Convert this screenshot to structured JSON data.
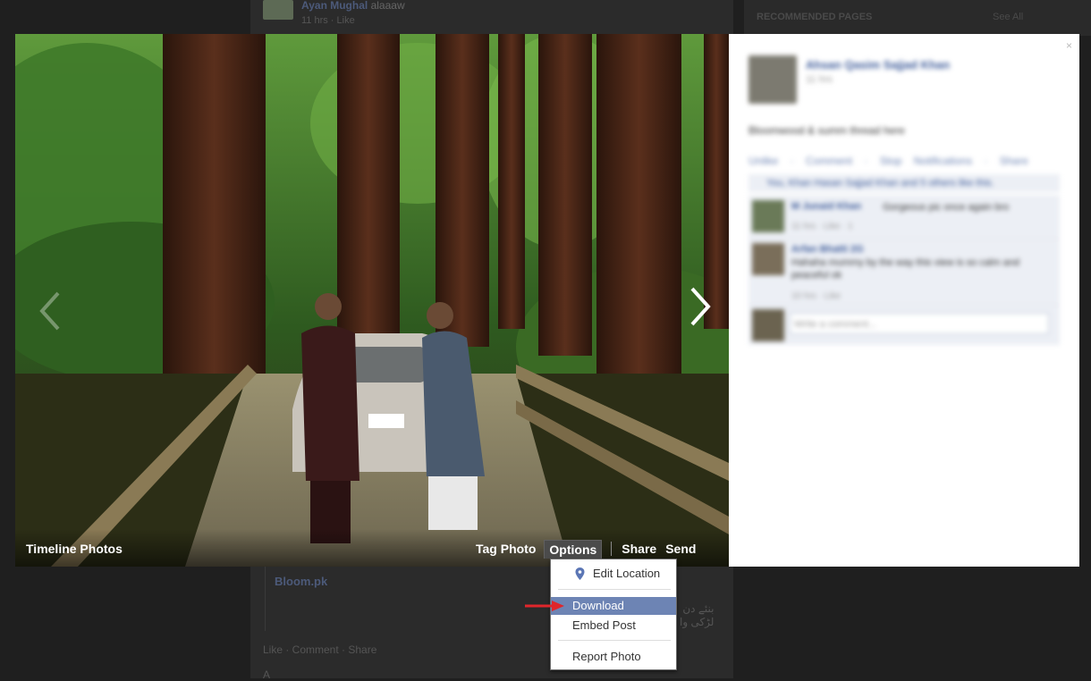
{
  "background": {
    "feed_author": "Ayan Mughal",
    "feed_status": "alaaaw",
    "feed_meta": "11 hrs · Like",
    "sidebar_heading": "RECOMMENDED PAGES",
    "sidebar_link": "See All",
    "post_title": "Bloom.pk",
    "urdu_line1": "بنئے دن",
    "urdu_line2": "لڑکی وا",
    "post_actions": "Like · Comment · Share",
    "stub": "A"
  },
  "viewer": {
    "album_title": "Timeline Photos",
    "actions": {
      "tag_photo": "Tag Photo",
      "options": "Options",
      "share": "Share",
      "send": "Send"
    },
    "icons": {
      "prev": "chevron-left-icon",
      "next": "chevron-right-icon"
    }
  },
  "options_menu": {
    "items": [
      {
        "label": "Edit Location",
        "icon": "location-pin-icon"
      },
      {
        "label": "Download",
        "selected": true
      },
      {
        "label": "Embed Post"
      },
      {
        "label": "Report Photo"
      }
    ]
  },
  "info_panel": {
    "author": "Ahsan Qasim Sajjad Khan",
    "time": "11 hrs",
    "caption": "Bloomwood & summ thread here",
    "links": "Unlike · Comment · Stop Notifications · Share",
    "likes_text": "You, Khan Hasan Sajjad Khan and 5 others like this.",
    "close_label": "×",
    "comments": [
      {
        "name": "M Junaid Khan",
        "text": "Gorgeous pic once again bro",
        "meta": "11 hrs · Like · 1"
      },
      {
        "name": "Arfan Bhatti 2G",
        "text": "Hahaha mummy by the way this view is so calm and peaceful ok",
        "meta": "10 hrs · Like"
      }
    ],
    "write_placeholder": "Write a comment..."
  },
  "colors": {
    "accent": "#3b5998",
    "menu_highlight": "#6d84b4",
    "annotation_arrow": "#e0262b"
  }
}
